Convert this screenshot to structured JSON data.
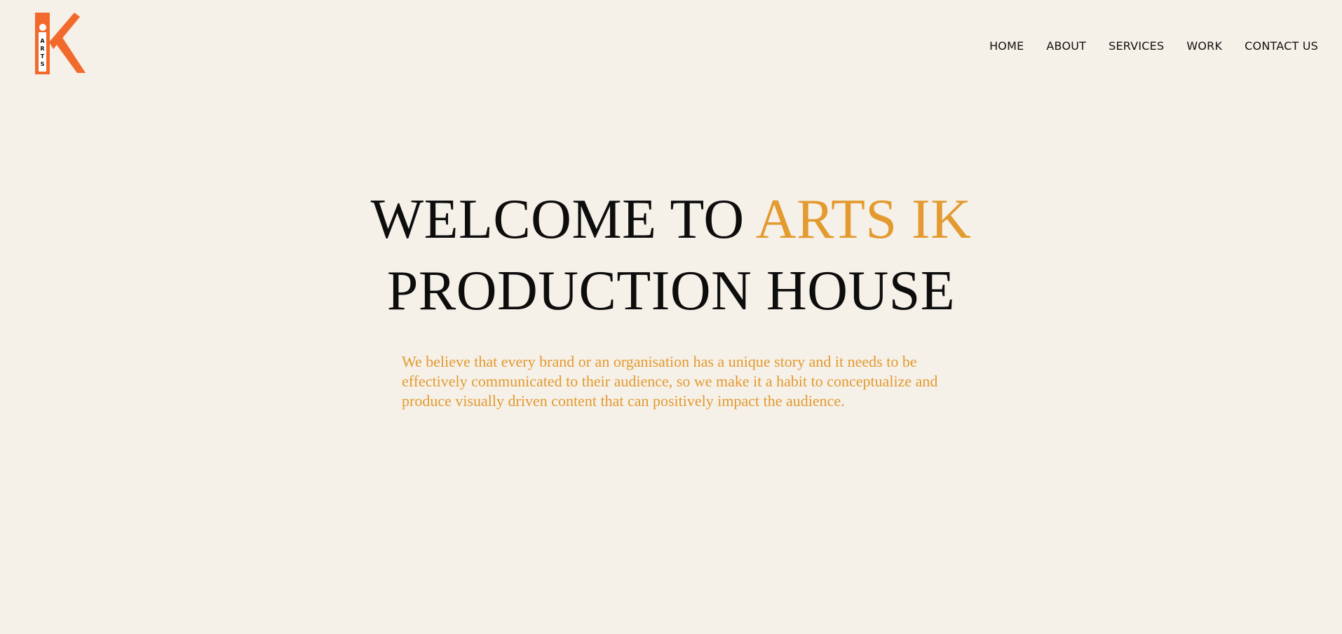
{
  "brand": {
    "logo_icon": "arts-ik-logo-icon",
    "logo_letters": "ARTS",
    "logo_color": "#f26a2b"
  },
  "nav": {
    "items": [
      {
        "label": "HOME"
      },
      {
        "label": "ABOUT"
      },
      {
        "label": "SERVICES"
      },
      {
        "label": "WORK"
      },
      {
        "label": "CONTACT US"
      }
    ]
  },
  "hero": {
    "title_part1": "WELCOME TO",
    "title_accent": "ARTS IK",
    "title_line2": "PRODUCTION HOUSE",
    "description": "We believe that every brand or an organisation has a unique story and it needs to be effectively communicated to their audience, so we make it a habit to conceptualize and produce visually driven content that can positively impact the audience."
  },
  "colors": {
    "background": "#f5f0e8",
    "accent": "#e39a2f",
    "text": "#0d0d0d",
    "logo": "#f26a2b"
  }
}
